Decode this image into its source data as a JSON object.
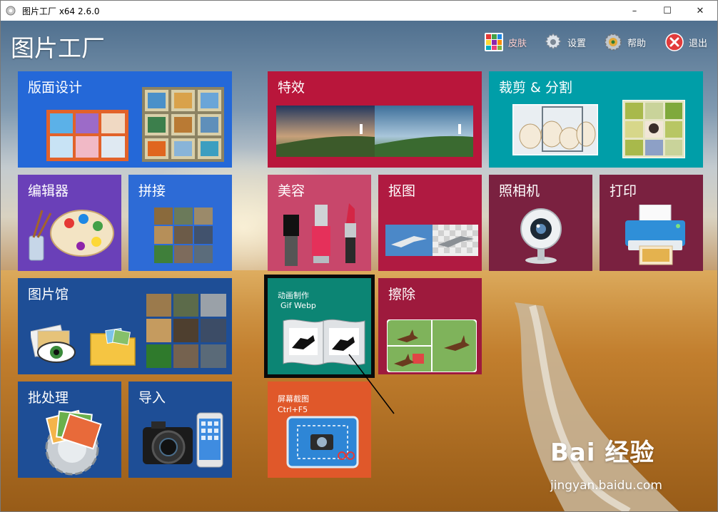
{
  "window": {
    "title": "图片工厂 x64 2.6.0",
    "controls": {
      "minimize": "–",
      "maximize": "☐",
      "close": "✕"
    }
  },
  "header": {
    "app_title": "图片工厂",
    "buttons": [
      {
        "label": "皮肤",
        "icon": "palette-grid-icon"
      },
      {
        "label": "设置",
        "icon": "gear-icon"
      },
      {
        "label": "帮助",
        "icon": "help-gear-icon"
      },
      {
        "label": "退出",
        "icon": "exit-icon"
      }
    ]
  },
  "tiles": {
    "layout": {
      "label": "版面设计"
    },
    "effects": {
      "label": "特效"
    },
    "crop": {
      "label": "裁剪 & 分割"
    },
    "editor": {
      "label": "编辑器"
    },
    "stitch": {
      "label": "拼接"
    },
    "beauty": {
      "label": "美容"
    },
    "cutout": {
      "label": "抠图"
    },
    "camera": {
      "label": "照相机"
    },
    "print": {
      "label": "打印"
    },
    "gallery": {
      "label": "图片馆"
    },
    "animate": {
      "label": "动画制作",
      "sub": "Gif Webp"
    },
    "erase": {
      "label": "擦除"
    },
    "batch": {
      "label": "批处理"
    },
    "import": {
      "label": "导入"
    },
    "screenshot": {
      "label": "屏幕截图",
      "shortcut": "Ctrl+F5"
    }
  },
  "watermark": {
    "brand": "Bai 经验",
    "url": "jingyan.baidu.com"
  },
  "colors": {
    "layout": "#2468d8",
    "effects": "#b9163b",
    "crop": "#009ea8",
    "editor": "#6a40b8",
    "stitch": "#2d6bd6",
    "beauty": "#c8476b",
    "cutout": "#b01a41",
    "camera": "#7a2140",
    "print": "#7a2140",
    "gallery": "#1e4e96",
    "animate": "#0c8574",
    "erase": "#9e1a3d",
    "batch": "#1e4e96",
    "import": "#1e4e96",
    "screenshot": "#e0582a"
  }
}
